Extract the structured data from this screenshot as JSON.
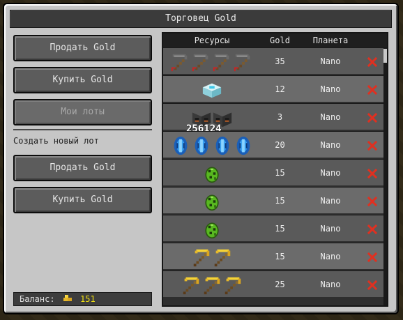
{
  "window": {
    "title": "Торговец Gold"
  },
  "left_panel": {
    "buttons_top": [
      {
        "label": "Продать Gold",
        "disabled": false
      },
      {
        "label": "Купить Gold",
        "disabled": false
      },
      {
        "label": "Мои лоты",
        "disabled": true
      }
    ],
    "section_label": "Создать новый лот",
    "buttons_bottom": [
      {
        "label": "Продать Gold"
      },
      {
        "label": "Купить Gold"
      }
    ],
    "balance": {
      "label": "Баланс:",
      "amount": "151"
    }
  },
  "table": {
    "headers": {
      "resources": "Ресурсы",
      "gold": "Gold",
      "planet": "Планета"
    },
    "rows": [
      {
        "items": [
          "stone-pickaxe-icon",
          "stone-pickaxe-icon",
          "stone-pickaxe-icon",
          "stone-pickaxe-icon"
        ],
        "gold": "35",
        "planet": "Nano"
      },
      {
        "items": [
          "beacon-block-icon"
        ],
        "gold": "12",
        "planet": "Nano"
      },
      {
        "items": [
          "furnace-block-icon",
          "furnace-block-icon"
        ],
        "stack_label": "256124",
        "gold": "3",
        "planet": "Nano"
      },
      {
        "items": [
          "blue-crystal-icon",
          "blue-crystal-icon",
          "blue-crystal-icon",
          "blue-crystal-icon"
        ],
        "gold": "20",
        "planet": "Nano"
      },
      {
        "items": [
          "spawn-egg-icon"
        ],
        "gold": "15",
        "planet": "Nano"
      },
      {
        "items": [
          "spawn-egg-icon"
        ],
        "gold": "15",
        "planet": "Nano"
      },
      {
        "items": [
          "spawn-egg-icon"
        ],
        "gold": "15",
        "planet": "Nano"
      },
      {
        "items": [
          "gold-pickaxe-icon",
          "gold-pickaxe-icon"
        ],
        "gold": "15",
        "planet": "Nano"
      },
      {
        "items": [
          "gold-pickaxe-icon",
          "gold-pickaxe-icon",
          "gold-pickaxe-icon"
        ],
        "gold": "25",
        "planet": "Nano"
      }
    ]
  },
  "colors": {
    "delete": "#e03020",
    "balance_amount": "#f0e010"
  }
}
